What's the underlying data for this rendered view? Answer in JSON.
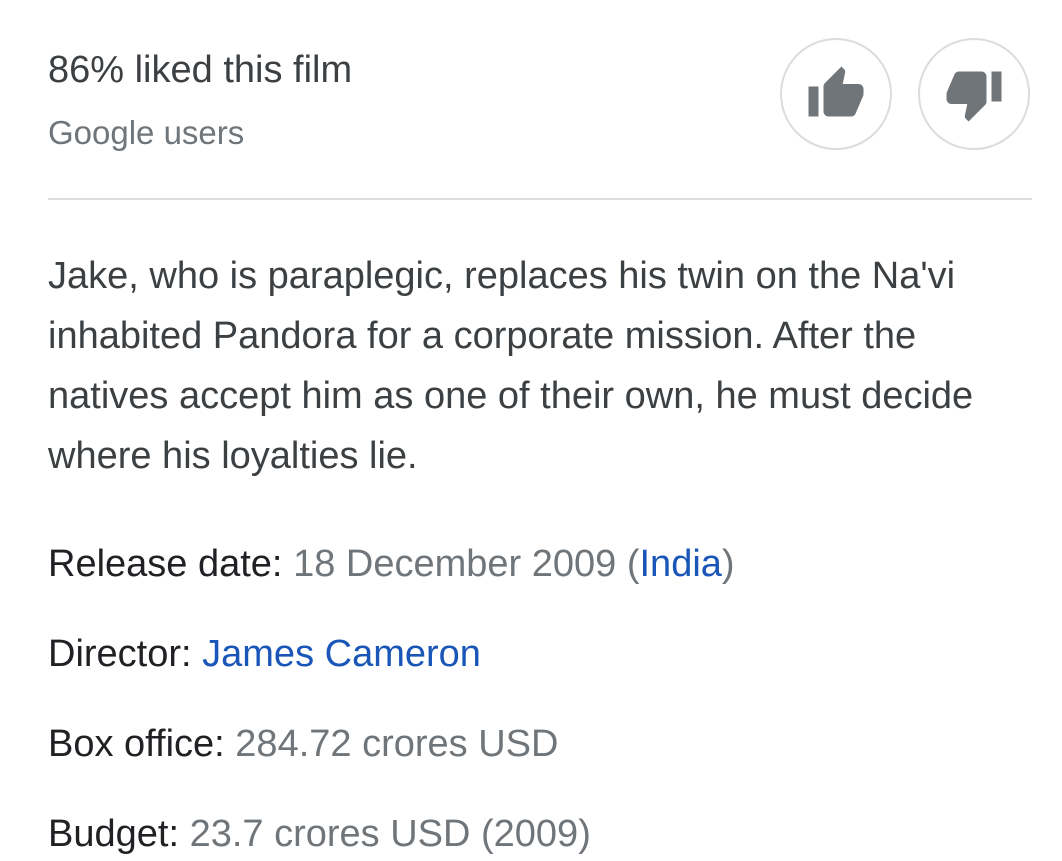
{
  "rating": {
    "title": "86% liked this film",
    "source": "Google users",
    "like_icon": "thumb-up-icon",
    "dislike_icon": "thumb-down-icon"
  },
  "description": "Jake, who is paraplegic, replaces his twin on the Na'vi inhabited Pandora for a corporate mission. After the natives accept him as one of their own, he must decide where his loyalties lie.",
  "facts": {
    "release": {
      "label": "Release date:",
      "value": "18 December 2009",
      "region": "India"
    },
    "director": {
      "label": "Director:",
      "value": "James Cameron"
    },
    "box_office": {
      "label": "Box office:",
      "value": "284.72 crores USD"
    },
    "budget": {
      "label": "Budget:",
      "value": "23.7 crores USD (2009)"
    }
  },
  "colors": {
    "link": "#1a55b8",
    "secondary_text": "#70757a",
    "divider": "#dadce0",
    "icon": "#70757a"
  }
}
